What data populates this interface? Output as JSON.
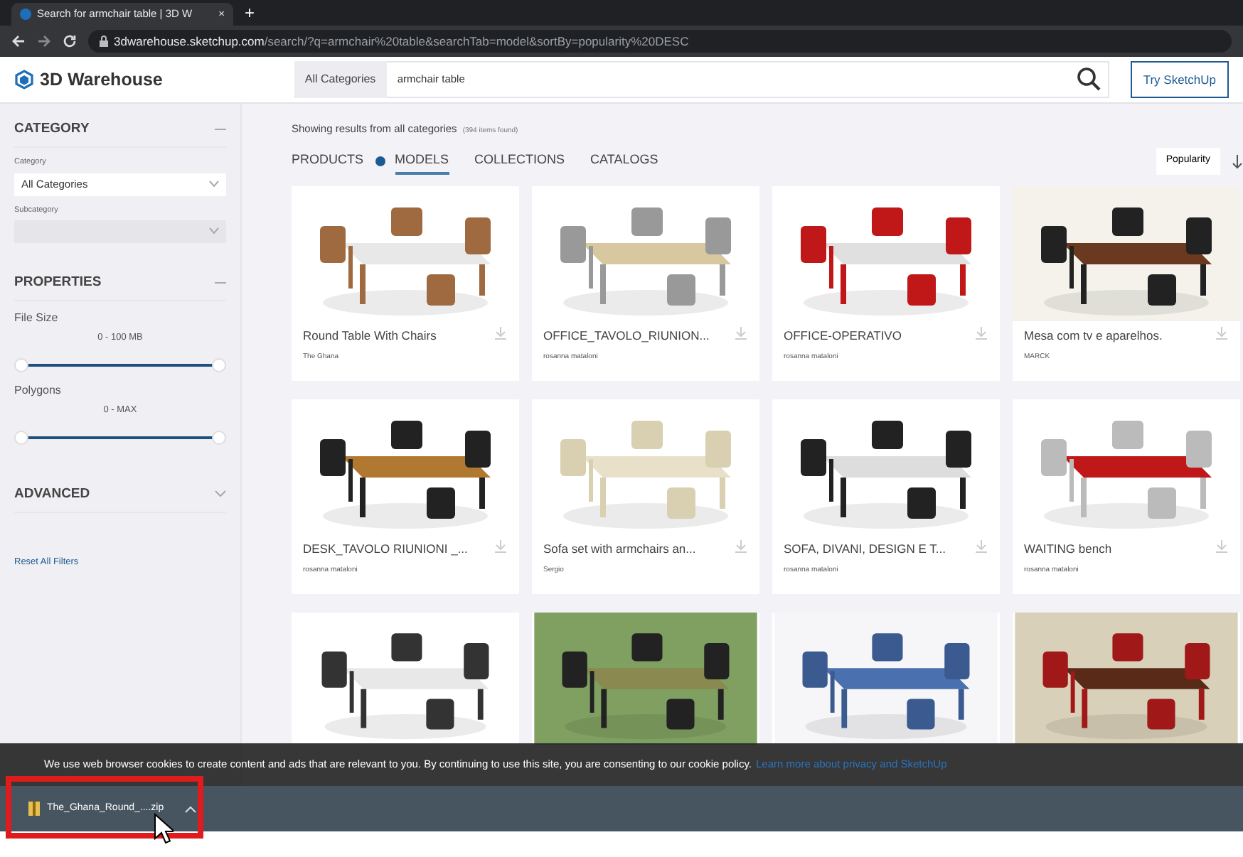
{
  "browser": {
    "tab_title": "Search for armchair table | 3D W",
    "tab_close": "×",
    "new_tab": "+",
    "url_host": "3dwarehouse.sketchup.com",
    "url_path": "/search/?q=armchair%20table&searchTab=model&sortBy=popularity%20DESC"
  },
  "header": {
    "logo": "3D Warehouse",
    "search_category": "All Categories",
    "search_query": "armchair table",
    "cta": "Try SketchUp"
  },
  "sidebar": {
    "sections": [
      {
        "title": "CATEGORY",
        "expanded": true,
        "kind": "category",
        "fields": [
          {
            "label": "Category",
            "value": "All Categories",
            "disabled": false
          },
          {
            "label": "Subcategory",
            "disabled": true
          }
        ]
      },
      {
        "title": "PROPERTIES",
        "expanded": true,
        "kind": "properties",
        "sliders": [
          {
            "label": "File Size",
            "range": "0 - 100 MB",
            "level": 1
          },
          {
            "label": "Polygons",
            "range": "0 - MAX",
            "level": 1
          }
        ]
      },
      {
        "title": "ADVANCED",
        "expanded": false
      }
    ],
    "reset": "Reset All Filters"
  },
  "results": {
    "summary": "Showing results from all categories",
    "count": "(394 items found)",
    "tabs": [
      {
        "label": "PRODUCTS",
        "selected": false,
        "info": true
      },
      {
        "label": "MODELS",
        "selected": true,
        "info": false
      },
      {
        "label": "COLLECTIONS",
        "selected": false,
        "info": false
      },
      {
        "label": "CATALOGS",
        "selected": false,
        "info": false
      }
    ],
    "sort": "Popularity",
    "cards": [
      {
        "kind": "titled",
        "title": "Round Table With Chairs",
        "author": "The Ghana"
      },
      {
        "kind": "titled",
        "title": "OFFICE_TAVOLO_RIUNION...",
        "author": "rosanna mataloni"
      },
      {
        "kind": "titled",
        "title": "OFFICE-OPERATIVO",
        "author": "rosanna mataloni"
      },
      {
        "kind": "titled",
        "title": "Mesa com tv e aparelhos.",
        "author": "MARCK"
      },
      {
        "kind": "titled",
        "title": "DESK_TAVOLO RIUNIONI _...",
        "author": "rosanna mataloni"
      },
      {
        "kind": "titled",
        "title": "Sofa set with armchairs an...",
        "author": "Sergio"
      },
      {
        "kind": "titled",
        "title": "SOFA, DIVANI, DESIGN E T...",
        "author": "rosanna mataloni"
      },
      {
        "kind": "titled",
        "title": "WAITING bench",
        "author": "rosanna mataloni"
      },
      {
        "kind": "picture"
      },
      {
        "kind": "picture"
      },
      {
        "kind": "picture"
      },
      {
        "kind": "picture"
      }
    ]
  },
  "cookie_banner": {
    "text": "We use web browser cookies to create content and ads that are relevant to you. By continuing to use this site, you are consenting to our cookie policy.",
    "link": "Learn more about privacy and SketchUp"
  },
  "download": {
    "filename": "The_Ghana_Round_....zip",
    "highlighted": true
  }
}
